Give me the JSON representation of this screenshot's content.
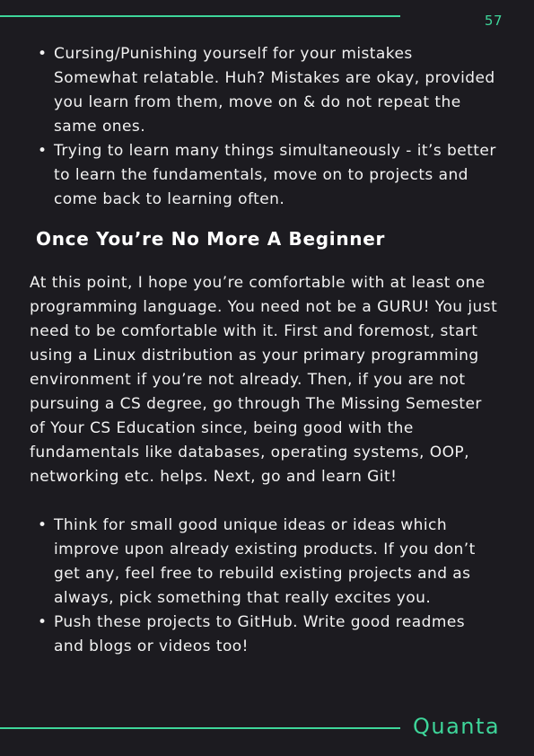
{
  "page": {
    "number": "57",
    "footer_brand": "Quanta"
  },
  "top_bullets": [
    {
      "line1": "Cursing/Punishing yourself for your mistakes",
      "line2": "Somewhat relatable. Huh? Mistakes are okay, provided",
      "line3": "you learn from them, move on & do not repeat the",
      "line4": "same ones."
    },
    {
      "line1": "Trying to learn many things simultaneously - it’s better",
      "line2": "to learn the fundamentals, move on to projects and",
      "line3": "come back to learning often."
    }
  ],
  "section": {
    "heading": "Once You’re No More A Beginner",
    "paragraph_lines": [
      "At this point, I hope you’re comfortable with at least one",
      "programming language. You need not be a GURU! You just",
      "need to be comfortable with it. First and foremost, start",
      "using a Linux distribution as your primary programming",
      "environment if you’re not already. Then, if you are not",
      "pursuing a CS degree, go through The Missing Semester",
      "of Your CS Education since, being good with the",
      "fundamentals like databases, operating systems, OOP,",
      "networking etc. helps. Next, go and learn Git!"
    ]
  },
  "bottom_bullets": [
    {
      "line1": "Think for small good unique ideas or ideas which",
      "line2": "improve upon already existing products. If you don’t",
      "line3": "get any, feel free to rebuild existing projects and as",
      "line4": "always, pick something that really excites you."
    },
    {
      "line1": "Push these projects to GitHub. Write good readmes",
      "line2": "and blogs or videos too!"
    }
  ],
  "bullet_glyph": "•"
}
